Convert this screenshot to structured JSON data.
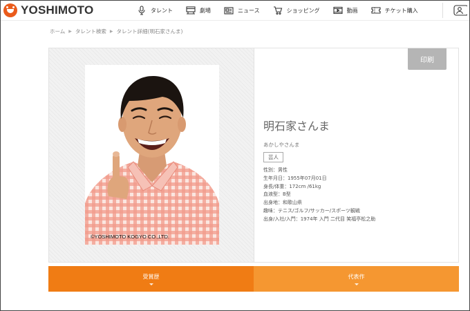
{
  "header": {
    "logo_text": "YOSHIMOTO",
    "nav": [
      {
        "label": "タレント",
        "icon": "mic-icon"
      },
      {
        "label": "劇場",
        "icon": "theater-icon"
      },
      {
        "label": "ニュース",
        "icon": "newspaper-icon"
      },
      {
        "label": "ショッピング",
        "icon": "cart-icon"
      },
      {
        "label": "動画",
        "icon": "video-icon"
      },
      {
        "label": "チケット購入",
        "icon": "ticket-icon"
      }
    ]
  },
  "breadcrumb": [
    "ホーム",
    "タレント検索",
    "タレント詳細(明石家さんま)"
  ],
  "profile": {
    "print_label": "印刷",
    "copyright": "©YOSHIMOTO KOGYO CO.,LTD.",
    "name": "明石家さんま",
    "reading": "あかしやさんま",
    "tag": "芸人",
    "details": [
      "性別：男性",
      "生年月日：1955年07月01日",
      "身長/体重：172cm /61kg",
      "血液型：B型",
      "出身地：和歌山県",
      "趣味：テニス/ゴルフ/サッカー/スポーツ観戦",
      "出身/入社/入門：1974年 入門 二代目 笑福亭松之助"
    ]
  },
  "tabs": [
    "受賞歴",
    "代表作"
  ],
  "colors": {
    "accent": "#ea5b1b",
    "tab_primary": "#f07c14",
    "tab_secondary": "#f59731",
    "print_button": "#b5b5b5"
  }
}
